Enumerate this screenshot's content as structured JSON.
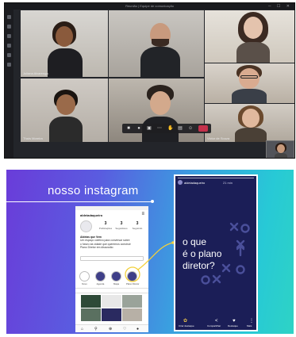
{
  "call": {
    "window_title": "Reunião | Equipe de comunicação",
    "window_controls": "─ ☐ ✕",
    "participants": [
      {
        "name": "Juliana Alvarenga"
      },
      {
        "name": ""
      },
      {
        "name": ""
      },
      {
        "name": "Thaís Moreira"
      },
      {
        "name": ""
      },
      {
        "name": ""
      },
      {
        "name": "Victor de Souza"
      }
    ],
    "controls": {
      "camera_icon": "video-camera",
      "mic_icon": "microphone",
      "share_icon": "share-screen",
      "more_icon": "more",
      "raise_hand_icon": "raise-hand",
      "chat_icon": "chat",
      "people_icon": "participants",
      "hangup_icon": "hang-up",
      "hangup_color": "#c4314b"
    }
  },
  "slide": {
    "title": "nosso instagram",
    "gradient": [
      "#6a3cd9",
      "#3a9fe0",
      "#2ed3c5"
    ],
    "profile": {
      "username": "aldeiadaqueiro",
      "stats": [
        {
          "value": "3",
          "label": "Publicações"
        },
        {
          "value": "3",
          "label": "Seguidores"
        },
        {
          "value": "3",
          "label": "Seguindo"
        }
      ],
      "bio": [
        "Aldeias que Vem",
        "Um espaço coletivo para conversar sobre",
        "o futuro da cidade que queremos construir",
        "Plano Diretor em discussão"
      ],
      "edit_label": "Editar perfil",
      "highlights": [
        "Novo",
        "Agenda",
        "Mapa",
        "Plano Diretor"
      ],
      "nav_icons": [
        "home",
        "search",
        "add",
        "heart",
        "profile"
      ]
    },
    "story": {
      "username": "aldeiadaqueiro",
      "time": "21 min",
      "question_lines": [
        "o que",
        "é o plano",
        "diretor?"
      ],
      "bottom_labels": [
        "Criar destaque",
        "Compartilhar",
        "Destaque",
        "Mais"
      ],
      "accent": "#1b1e57"
    }
  }
}
